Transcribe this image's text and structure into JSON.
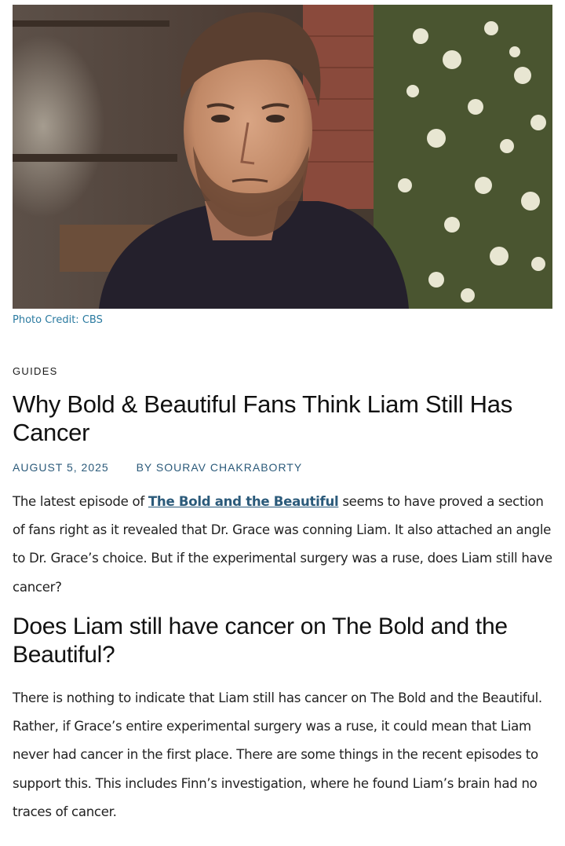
{
  "hero_image": {
    "alt": "Man with short brown hair and beard in a dark shirt looking to the side, flowers in background"
  },
  "photo_credit": "Photo Credit: CBS",
  "category": "GUIDES",
  "title": "Why Bold & Beautiful Fans Think Liam Still Has Cancer",
  "meta": {
    "date": "AUGUST 5, 2025",
    "author": "BY SOURAV CHAKRABORTY"
  },
  "intro": {
    "before_link": "The latest episode of ",
    "link_text": "The Bold and the Beautiful",
    "after_link": " seems to have proved a section of fans right as it revealed that Dr. Grace was conning Liam. It also attached an angle to Dr. Grace’s choice. But if the experimental surgery was a ruse, does Liam still have cancer?"
  },
  "section_heading": "Does Liam still have cancer on The Bold and the Beautiful?",
  "section_body": "There is nothing to indicate that Liam still has cancer on The Bold and the Beautiful. Rather, if Grace’s entire experimental surgery was a ruse, it could mean that Liam never had cancer in the first place. There are some things in the recent episodes to support this. This includes Finn’s investigation, where he found Liam’s brain had no traces of cancer."
}
